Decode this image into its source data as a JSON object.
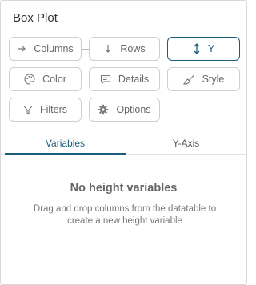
{
  "panel": {
    "title": "Box Plot"
  },
  "buttons": {
    "columns": {
      "label": "Columns",
      "icon": "arrow-right-icon"
    },
    "rows": {
      "label": "Rows",
      "icon": "arrow-down-icon"
    },
    "y": {
      "label": "Y",
      "icon": "vertical-resize-icon",
      "active": true
    },
    "color": {
      "label": "Color",
      "icon": "palette-icon"
    },
    "details": {
      "label": "Details",
      "icon": "message-icon"
    },
    "style": {
      "label": "Style",
      "icon": "brush-icon"
    },
    "filters": {
      "label": "Filters",
      "icon": "filter-icon"
    },
    "options": {
      "label": "Options",
      "icon": "gear-icon"
    }
  },
  "tabs": [
    {
      "label": "Variables",
      "active": true
    },
    {
      "label": "Y-Axis",
      "active": false
    }
  ],
  "empty_state": {
    "title": "No height variables",
    "description": "Drag and drop columns from the datatable to create a new height variable"
  },
  "colors": {
    "accent": "#1a5d7a",
    "border": "#cfcfcf",
    "text": "#666666"
  }
}
